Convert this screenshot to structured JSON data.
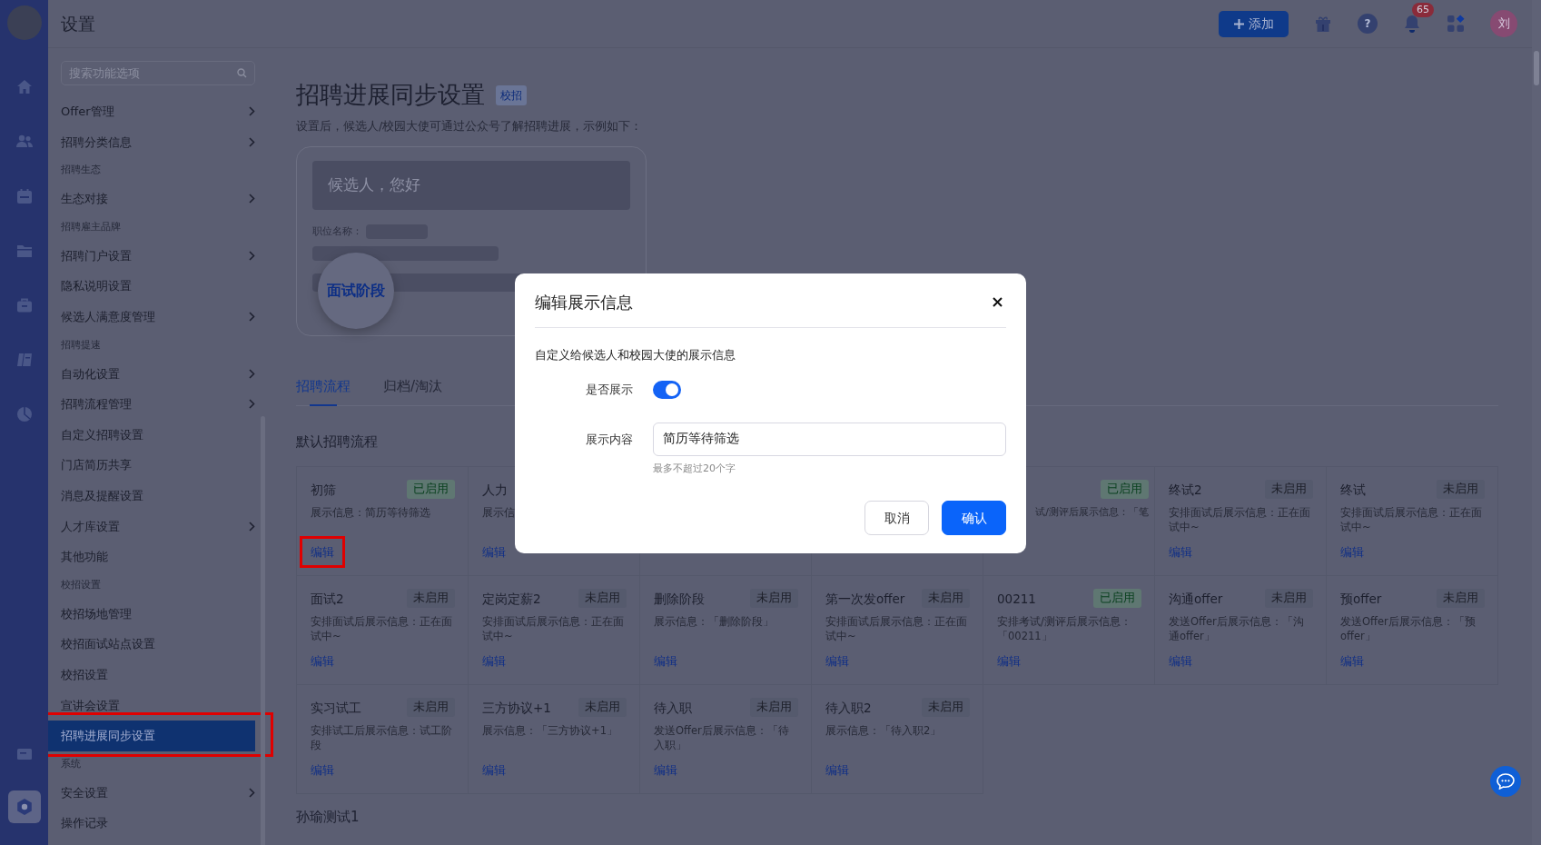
{
  "rail": {
    "items": [
      {
        "kind": "home",
        "selected": false
      },
      {
        "kind": "people",
        "selected": false
      },
      {
        "kind": "calendar",
        "selected": false
      },
      {
        "kind": "folder",
        "selected": false
      },
      {
        "kind": "briefcase",
        "selected": false
      },
      {
        "kind": "book",
        "selected": false
      },
      {
        "kind": "chart",
        "selected": false
      },
      {
        "kind": "card",
        "selected": false
      },
      {
        "kind": "gear",
        "selected": true
      }
    ]
  },
  "header": {
    "title": "设置",
    "add_button": "添加",
    "help_label": "?",
    "notification_count": "65",
    "user_initial": "刘"
  },
  "sidebar": {
    "search_placeholder": "搜索功能选项",
    "items": [
      {
        "kind": "item",
        "label": "Offer管理",
        "has_submenu": true,
        "selected": false,
        "highlighted": false
      },
      {
        "kind": "item",
        "label": "招聘分类信息",
        "has_submenu": true,
        "selected": false,
        "highlighted": false
      },
      {
        "kind": "group",
        "label": "招聘生态"
      },
      {
        "kind": "item",
        "label": "生态对接",
        "has_submenu": true,
        "selected": false,
        "highlighted": false
      },
      {
        "kind": "group",
        "label": "招聘雇主品牌"
      },
      {
        "kind": "item",
        "label": "招聘门户设置",
        "has_submenu": true,
        "selected": false,
        "highlighted": false
      },
      {
        "kind": "item",
        "label": "隐私说明设置",
        "has_submenu": false,
        "selected": false,
        "highlighted": false
      },
      {
        "kind": "item",
        "label": "候选人满意度管理",
        "has_submenu": true,
        "selected": false,
        "highlighted": false
      },
      {
        "kind": "group",
        "label": "招聘提速"
      },
      {
        "kind": "item",
        "label": "自动化设置",
        "has_submenu": true,
        "selected": false,
        "highlighted": false
      },
      {
        "kind": "item",
        "label": "招聘流程管理",
        "has_submenu": true,
        "selected": false,
        "highlighted": false
      },
      {
        "kind": "item",
        "label": "自定义招聘设置",
        "has_submenu": false,
        "selected": false,
        "highlighted": false
      },
      {
        "kind": "item",
        "label": "门店简历共享",
        "has_submenu": false,
        "selected": false,
        "highlighted": false
      },
      {
        "kind": "item",
        "label": "消息及提醒设置",
        "has_submenu": false,
        "selected": false,
        "highlighted": false
      },
      {
        "kind": "item",
        "label": "人才库设置",
        "has_submenu": true,
        "selected": false,
        "highlighted": false
      },
      {
        "kind": "item",
        "label": "其他功能",
        "has_submenu": false,
        "selected": false,
        "highlighted": false
      },
      {
        "kind": "group",
        "label": "校招设置"
      },
      {
        "kind": "item",
        "label": "校招场地管理",
        "has_submenu": false,
        "selected": false,
        "highlighted": false
      },
      {
        "kind": "item",
        "label": "校招面试站点设置",
        "has_submenu": false,
        "selected": false,
        "highlighted": false
      },
      {
        "kind": "item",
        "label": "校招设置",
        "has_submenu": false,
        "selected": false,
        "highlighted": false
      },
      {
        "kind": "item",
        "label": "宣讲会设置",
        "has_submenu": false,
        "selected": false,
        "highlighted": false
      },
      {
        "kind": "item",
        "label": "招聘进展同步设置",
        "has_submenu": false,
        "selected": true,
        "highlighted": true
      },
      {
        "kind": "group",
        "label": "系统"
      },
      {
        "kind": "item",
        "label": "安全设置",
        "has_submenu": true,
        "selected": false,
        "highlighted": false
      },
      {
        "kind": "item",
        "label": "操作记录",
        "has_submenu": false,
        "selected": false,
        "highlighted": false
      }
    ]
  },
  "page": {
    "title": "招聘进展同步设置",
    "tag": "校招",
    "description": "设置后，候选人/校园大使可通过公众号了解招聘进展，示例如下：",
    "preview": {
      "greeting": "候选人，您好",
      "field_label": "职位名称：",
      "stage": "面试阶段"
    },
    "tabs": [
      {
        "label": "招聘流程",
        "selected": true
      },
      {
        "label": "归档/淘汰",
        "selected": false
      }
    ],
    "section_title": "默认招聘流程",
    "stages": [
      {
        "kind": "stage",
        "name": "初筛",
        "status": "已启用",
        "enabled": true,
        "info": "展示信息：简历等待筛选",
        "action": "编辑",
        "highlighted": true
      },
      {
        "kind": "cutoff",
        "name": "人力",
        "info": "展示信",
        "action": "编辑"
      },
      {
        "kind": "hidden"
      },
      {
        "kind": "hidden"
      },
      {
        "kind": "tail",
        "status": "已启用",
        "enabled": true,
        "info": "试/测评后展示信息：「笔"
      },
      {
        "kind": "stage",
        "name": "终试2",
        "status": "未启用",
        "enabled": false,
        "info": "安排面试后展示信息：正在面试中~",
        "action": "编辑",
        "highlighted": false
      },
      {
        "kind": "stage",
        "name": "终试",
        "status": "未启用",
        "enabled": false,
        "info": "安排面试后展示信息：正在面试中~",
        "action": "编辑",
        "highlighted": false
      },
      {
        "kind": "stage",
        "name": "面试2",
        "status": "未启用",
        "enabled": false,
        "info": "安排面试后展示信息：正在面试中~",
        "action": "编辑",
        "highlighted": false
      },
      {
        "kind": "stage",
        "name": "定岗定薪2",
        "status": "未启用",
        "enabled": false,
        "info": "安排面试后展示信息：正在面试中~",
        "action": "编辑",
        "highlighted": false
      },
      {
        "kind": "stage",
        "name": "删除阶段",
        "status": "未启用",
        "enabled": false,
        "info": "展示信息：「删除阶段」",
        "action": "编辑",
        "highlighted": false
      },
      {
        "kind": "stage",
        "name": "第一次发offer",
        "status": "未启用",
        "enabled": false,
        "info": "安排面试后展示信息：正在面试中~",
        "action": "编辑",
        "highlighted": false
      },
      {
        "kind": "stage",
        "name": "00211",
        "status": "已启用",
        "enabled": true,
        "info": "安排考试/测评后展示信息：「00211」",
        "action": "编辑",
        "highlighted": false
      },
      {
        "kind": "stage",
        "name": "沟通offer",
        "status": "未启用",
        "enabled": false,
        "info": "发送Offer后展示信息：「沟通offer」",
        "action": "编辑",
        "highlighted": false
      },
      {
        "kind": "stage",
        "name": "预offer",
        "status": "未启用",
        "enabled": false,
        "info": "发送Offer后展示信息：「预offer」",
        "action": "编辑",
        "highlighted": false
      },
      {
        "kind": "stage",
        "name": "实习试工",
        "status": "未启用",
        "enabled": false,
        "info": "安排试工后展示信息：试工阶段",
        "action": "编辑",
        "highlighted": false
      },
      {
        "kind": "stage",
        "name": "三方协议+1",
        "status": "未启用",
        "enabled": false,
        "info": "展示信息：「三方协议+1」",
        "action": "编辑",
        "highlighted": false
      },
      {
        "kind": "stage",
        "name": "待入职",
        "status": "未启用",
        "enabled": false,
        "info": "发送Offer后展示信息：「待入职」",
        "action": "编辑",
        "highlighted": false
      },
      {
        "kind": "stage",
        "name": "待入职2",
        "status": "未启用",
        "enabled": false,
        "info": "展示信息：「待入职2」",
        "action": "编辑",
        "highlighted": false
      }
    ],
    "next_section_title": "孙瑜测试1"
  },
  "modal": {
    "title": "编辑展示信息",
    "description": "自定义给候选人和校园大使的展示信息",
    "show_label": "是否展示",
    "show_on": true,
    "content_label": "展示内容",
    "content_value": "简历等待筛选",
    "hint": "最多不超过20个字",
    "buttons": [
      {
        "label": "取消",
        "kind": "secondary"
      },
      {
        "label": "确认",
        "kind": "primary"
      }
    ]
  }
}
